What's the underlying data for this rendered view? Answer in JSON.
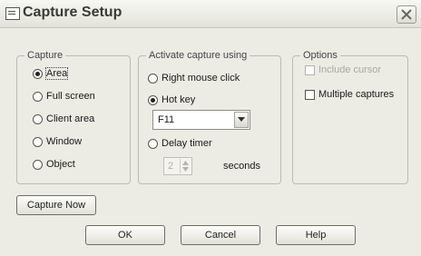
{
  "window": {
    "title": "Capture Setup"
  },
  "capture": {
    "legend": "Capture",
    "options": [
      {
        "label": "Area",
        "selected": true
      },
      {
        "label": "Full screen",
        "selected": false
      },
      {
        "label": "Client area",
        "selected": false
      },
      {
        "label": "Window",
        "selected": false
      },
      {
        "label": "Object",
        "selected": false
      }
    ]
  },
  "activate": {
    "legend": "Activate capture using",
    "right_click": {
      "label": "Right mouse click",
      "selected": false
    },
    "hot_key": {
      "label": "Hot key",
      "selected": true,
      "value": "F11"
    },
    "delay_timer": {
      "label": "Delay timer",
      "selected": false,
      "value": "2",
      "unit": "seconds"
    }
  },
  "options": {
    "legend": "Options",
    "include_cursor": {
      "label": "Include cursor",
      "checked": false,
      "enabled": false
    },
    "multiple_captures": {
      "label": "Multiple captures",
      "checked": false,
      "enabled": true
    }
  },
  "buttons": {
    "capture_now": "Capture Now",
    "ok": "OK",
    "cancel": "Cancel",
    "help": "Help"
  }
}
